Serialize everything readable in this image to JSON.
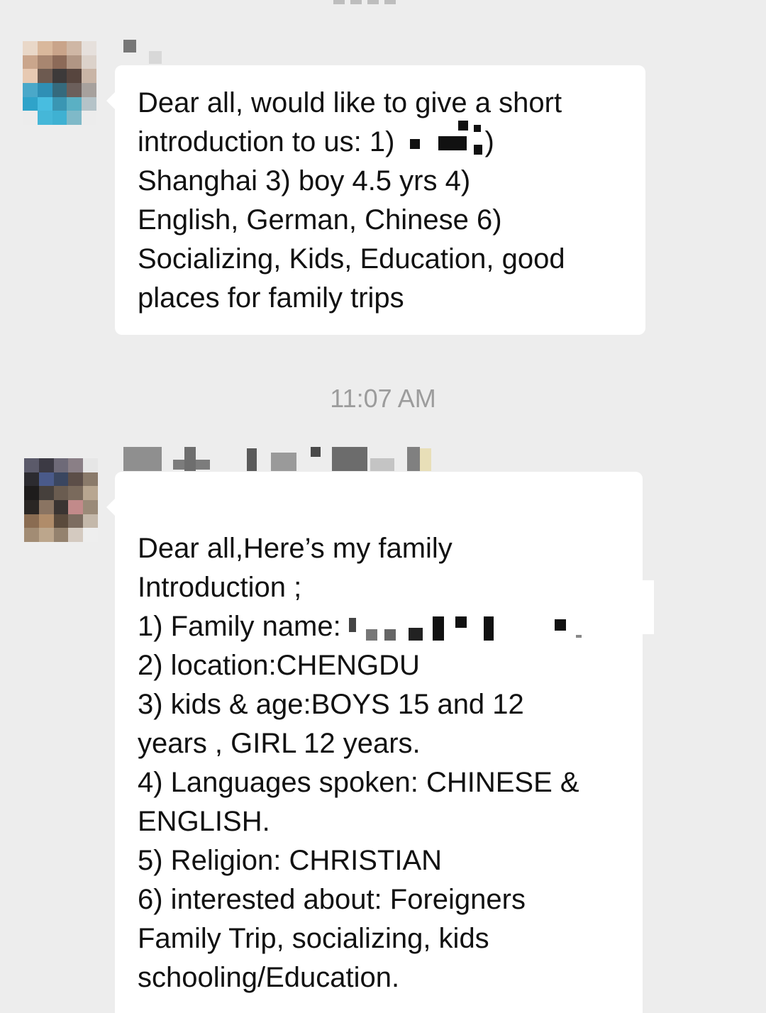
{
  "messages": [
    {
      "lines": [
        "Dear all, would like to give a short",
        "introduction to us: 1)",
        ")",
        "Shanghai 3) boy 4.5 yrs 4)",
        "English, German, Chinese 6)",
        "Socializing, Kids, Education, good",
        "places for family trips"
      ]
    },
    {
      "lines": [
        "Dear all,Here’s my family",
        "Introduction ;",
        "1) Family name:",
        "2) location:CHENGDU",
        "3) kids & age:BOYS 15 and 12",
        "years , GIRL 12 years.",
        "4) Languages spoken: CHINESE &",
        "ENGLISH.",
        "5) Religion: CHRISTIAN",
        "6) interested about: Foreigners",
        "Family Trip, socializing, kids",
        "schooling/Education."
      ]
    }
  ],
  "timestamp": "11:07 AM"
}
